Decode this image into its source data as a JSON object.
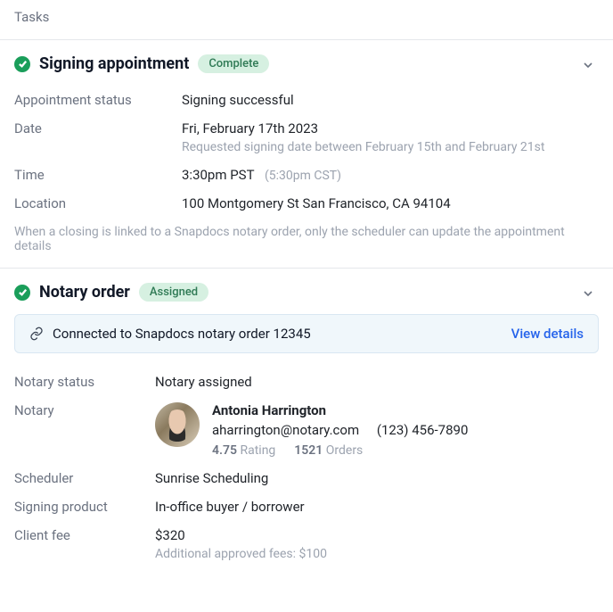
{
  "tasks_header": "Tasks",
  "signing": {
    "title": "Signing appointment",
    "status_pill": "Complete",
    "labels": {
      "status": "Appointment status",
      "date": "Date",
      "time": "Time",
      "location": "Location"
    },
    "values": {
      "status": "Signing successful",
      "date": "Fri, February 17th 2023",
      "date_sub": "Requested signing date between February 15th and February 21st",
      "time": "3:30pm PST",
      "time_alt": "(5:30pm CST)",
      "location": "100 Montgomery St San Francisco, CA 94104"
    },
    "footer_note": "When a closing is linked to a Snapdocs notary order, only the scheduler can update the appointment details"
  },
  "notary_order": {
    "title": "Notary order",
    "status_pill": "Assigned",
    "connected_text": "Connected to Snapdocs notary order 12345",
    "view_details": "View details",
    "labels": {
      "notary_status": "Notary status",
      "notary": "Notary",
      "scheduler": "Scheduler",
      "signing_product": "Signing product",
      "client_fee": "Client fee"
    },
    "values": {
      "notary_status": "Notary assigned",
      "notary": {
        "name": "Antonia Harrington",
        "email": "aharrington@notary.com",
        "phone": "(123) 456-7890",
        "rating": "4.75",
        "rating_label": "Rating",
        "orders": "1521",
        "orders_label": "Orders"
      },
      "scheduler": "Sunrise Scheduling",
      "signing_product": "In-office buyer / borrower",
      "client_fee": "$320",
      "client_fee_sub": "Additional approved fees: $100"
    }
  }
}
